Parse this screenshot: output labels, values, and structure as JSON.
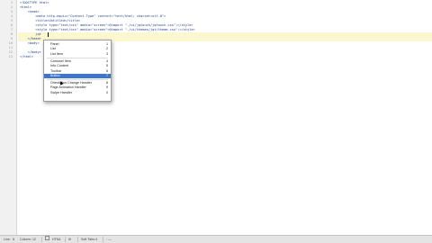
{
  "editor": {
    "line_numbers": [
      "1",
      "2",
      "3",
      "4",
      "5",
      "6",
      "7",
      "8",
      "9",
      "10",
      "11",
      "12",
      "13"
    ],
    "lines": [
      "<!DOCTYPE html>",
      "<html>",
      "    <head>",
      "        <meta http-equiv=\"Content-Type\" content=\"text/html; charset=utf-8\">",
      "        <title>Untitled</title>",
      "        <style type=\"text/css\" media=\"screen\">@import \"./ui/jqtouch/jqtouch.css\";</style>",
      "        <style type=\"text/css\" media=\"screen\">@import \"./ui/themes/jqt/theme.css\";</style>",
      "        jqt",
      "    </head>",
      "    <body>",
      "",
      "    </body>",
      "</html>"
    ]
  },
  "popup": {
    "items": [
      {
        "label": "Panel",
        "key": "1"
      },
      {
        "label": "List",
        "key": "2"
      },
      {
        "label": "List Item",
        "key": "3"
      },
      {
        "label": "Carousel Item",
        "key": "4"
      },
      {
        "label": "Info Content",
        "key": "5"
      },
      {
        "label": "Toolbar",
        "key": "6"
      },
      {
        "label": "Button",
        "key": "7"
      },
      {
        "label": "Orientation Change Handler",
        "key": "8"
      },
      {
        "label": "Page Animation Handler",
        "key": "9"
      },
      {
        "label": "Swipe Handler",
        "key": "0"
      }
    ],
    "selected_index": 6
  },
  "status": {
    "line_label": "Line:",
    "line_value": "8",
    "column_label": "Column:",
    "column_value": "12",
    "language": "HTML",
    "tab_label": "Soft Tabs:",
    "tab_value": "4"
  },
  "colors": {
    "selection": "#3875d7",
    "current_line": "#fbf8cf"
  }
}
